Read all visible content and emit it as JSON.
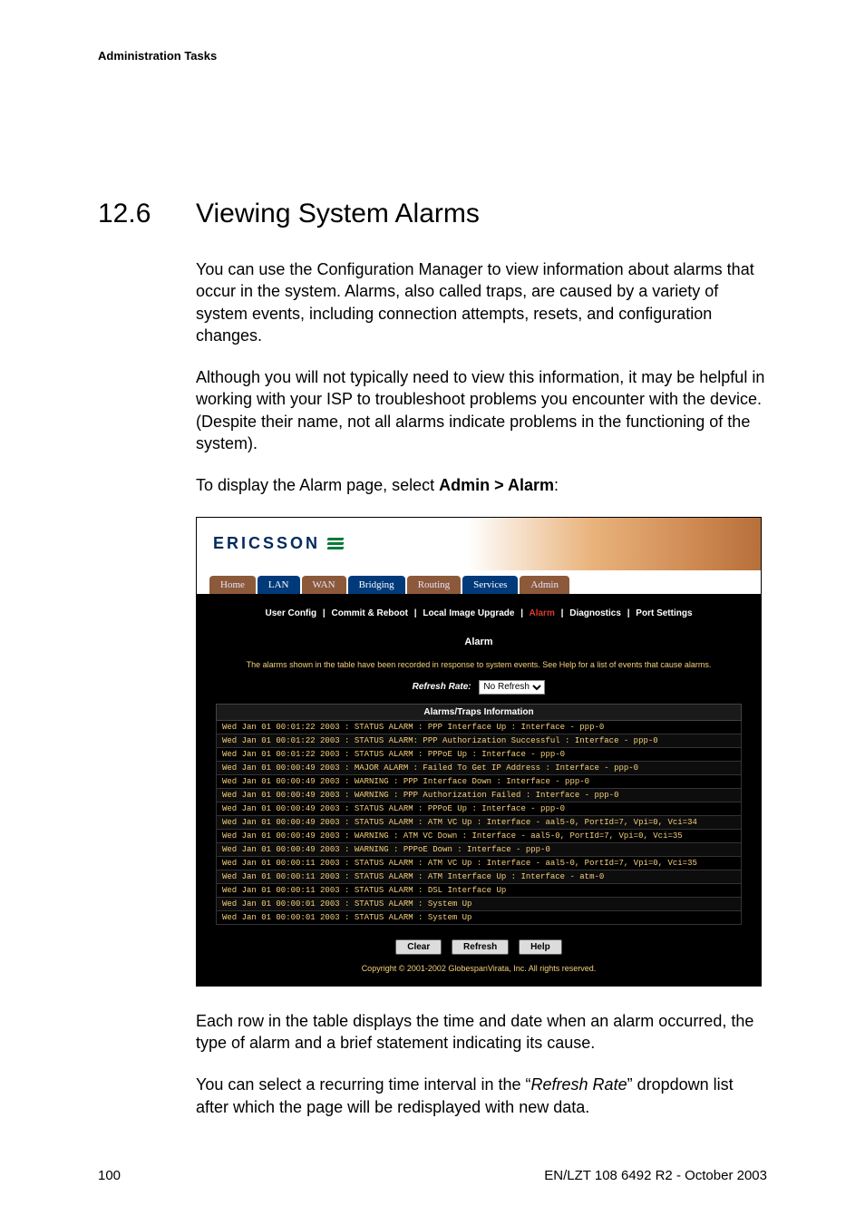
{
  "doc": {
    "running_head": "Administration Tasks",
    "section_number": "12.6",
    "section_title": "Viewing System Alarms",
    "p1": "You can use the Configuration Manager to view information about alarms that occur in the system. Alarms, also called traps, are caused by a variety of system events, including connection attempts, resets, and configuration changes.",
    "p2": "Although you will not typically need to view this information, it may be helpful in working with your ISP to troubleshoot problems you encounter with the device. (Despite their name, not all alarms indicate problems in the functioning of the system).",
    "p3_prefix": "To display the Alarm page, select ",
    "p3_bold": "Admin > Alarm",
    "p3_suffix": ":",
    "p4": "Each row in the table displays the time and date when an alarm occurred, the type of alarm and a brief statement indicating its cause.",
    "p5_a": "You can select a recurring time interval in the “",
    "p5_i": "Refresh Rate",
    "p5_b": "” dropdown list after which the page will be redisplayed with new data.",
    "page_number": "100",
    "doc_id": "EN/LZT 108 6492 R2  - October 2003"
  },
  "screenshot": {
    "brand": "ERICSSON",
    "tabs": [
      "Home",
      "LAN",
      "WAN",
      "Bridging",
      "Routing",
      "Services",
      "Admin"
    ],
    "subnav": [
      {
        "label": "User Config",
        "active": false
      },
      {
        "label": "Commit & Reboot",
        "active": false
      },
      {
        "label": "Local Image Upgrade",
        "active": false
      },
      {
        "label": "Alarm",
        "active": true
      },
      {
        "label": "Diagnostics",
        "active": false
      },
      {
        "label": "Port Settings",
        "active": false
      }
    ],
    "page_title": "Alarm",
    "note": "The alarms shown in the table have been recorded in response to system events. See Help for a list of events that cause alarms.",
    "refresh_label": "Refresh Rate:",
    "refresh_value": "No Refresh",
    "table_header": "Alarms/Traps Information",
    "rows": [
      "Wed Jan 01 00:01:22 2003 : STATUS ALARM : PPP Interface Up : Interface - ppp-0",
      "Wed Jan 01 00:01:22 2003 : STATUS ALARM: PPP Authorization Successful : Interface - ppp-0",
      "Wed Jan 01 00:01:22 2003 : STATUS ALARM : PPPoE Up : Interface - ppp-0",
      "Wed Jan 01 00:00:49 2003 : MAJOR ALARM : Failed To Get IP Address : Interface - ppp-0",
      "Wed Jan 01 00:00:49 2003 : WARNING : PPP Interface Down : Interface - ppp-0",
      "Wed Jan 01 00:00:49 2003 : WARNING : PPP Authorization Failed : Interface - ppp-0",
      "Wed Jan 01 00:00:49 2003 : STATUS ALARM : PPPoE Up : Interface - ppp-0",
      "Wed Jan 01 00:00:49 2003 : STATUS ALARM : ATM VC Up : Interface - aal5-0, PortId=7, Vpi=0, Vci=34",
      "Wed Jan 01 00:00:49 2003 : WARNING : ATM VC Down : Interface - aal5-0, PortId=7, Vpi=0, Vci=35",
      "Wed Jan 01 00:00:49 2003 : WARNING : PPPoE Down : Interface - ppp-0",
      "Wed Jan 01 00:00:11 2003 : STATUS ALARM : ATM VC Up : Interface - aal5-0, PortId=7, Vpi=0, Vci=35",
      "Wed Jan 01 00:00:11 2003 : STATUS ALARM : ATM Interface Up : Interface - atm-0",
      "Wed Jan 01 00:00:11 2003 : STATUS ALARM : DSL Interface Up",
      "Wed Jan 01 00:00:01 2003 : STATUS ALARM : System Up",
      "Wed Jan 01 00:00:01 2003 : STATUS ALARM : System Up"
    ],
    "buttons": {
      "clear": "Clear",
      "refresh": "Refresh",
      "help": "Help"
    },
    "copyright": "Copyright © 2001-2002 GlobespanVirata, Inc. All rights reserved."
  }
}
